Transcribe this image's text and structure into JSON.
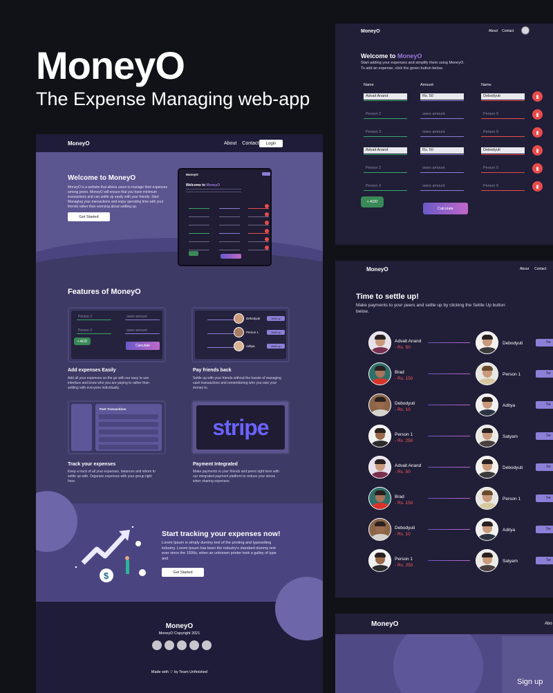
{
  "hero": {
    "title": "MoneyO",
    "subtitle": "The Expense Managing web-app"
  },
  "landing": {
    "nav": {
      "brand": "MoneyO",
      "links": [
        "About",
        "Contact"
      ],
      "login": "Login"
    },
    "welcome_title": "Welcome to MoneyO",
    "welcome_text": "MoneyO is a website that allows users to manage their expenses among peers. MoneyO will ensure that you have minimum transactions and can settle up easily with your friends. Start Managing your transactions and enjoy spending time with your friends rather than worrying about settling up.",
    "get_started": "Get Started",
    "features_title": "Features of MoneyO",
    "features": [
      {
        "title": "Add expenses Easily",
        "text": "Add all your expenses on the go with our easy to use interface and know who you are paying to rather than settling with everyone individually."
      },
      {
        "title": "Pay friends back",
        "text": "Settle up with your friends without the hassle of managing cash transactions and remembering who you owe your money to."
      },
      {
        "title": "Track your expenses",
        "text": "Keep a track of all your expenses, balances and whom to settle up with. Organize expenses with your group right here."
      },
      {
        "title": "Payment Integrated",
        "text": "Make payments to your friends and peers right here with our integrated payment platform to reduce your stress when sharing expenses."
      }
    ],
    "feature1_card": {
      "person2": "Person 2",
      "person3": "Person 3",
      "owes": "owes amount",
      "add": "+ ADD",
      "calculate": "Calculate"
    },
    "feature2_card": {
      "names": [
        "Debodyuti",
        "Person 1",
        "Aditya"
      ],
      "btn": "Settle up"
    },
    "feature3_card": {
      "title": "Past Transactions"
    },
    "stripe": "stripe",
    "cta_title": "Start tracking your expenses now!",
    "cta_text": "Lorem Ipsum is simply dummy text of the printing and typesetting industry. Lorem Ipsum has been the industry's standard dummy text ever since the 1500s, when an unknown printer took a galley of type and",
    "cta_btn": "Get Started",
    "footer": {
      "brand": "MoneyO",
      "copyright": "MoneyO Copyright 2021",
      "made": "Made with ♡ by Team Unfinished"
    }
  },
  "expense_panel": {
    "brand": "MoneyO",
    "links": [
      "About",
      "Contact"
    ],
    "welcome_prefix": "Welcome to ",
    "welcome_brand": "MoneyO",
    "sub1": "Start adding your expenses and simplify them using MoneyO.",
    "sub2": "To add an expense, click the green button below.",
    "headers": [
      "Name",
      "Amount",
      "Name"
    ],
    "rows": [
      {
        "a": "Advait Anand",
        "amt": "Rs. 50",
        "b": "Debodyuti",
        "filled": true
      },
      {
        "a": "Person 2",
        "amt": "owes amount",
        "b": "Person 5",
        "filled": false
      },
      {
        "a": "Person 3",
        "amt": "owes amount",
        "b": "Person 6",
        "filled": false
      },
      {
        "a": "Advait Anand",
        "amt": "Rs. 50",
        "b": "Debodyuti",
        "filled": true
      },
      {
        "a": "Person 2",
        "amt": "owes amount",
        "b": "Person 5",
        "filled": false
      },
      {
        "a": "Person 3",
        "amt": "owes amount",
        "b": "Person 6",
        "filled": false
      }
    ],
    "add": "+ ADD",
    "calculate": "Calculate"
  },
  "settle_panel": {
    "brand": "MoneyO",
    "links": [
      "About",
      "Contact"
    ],
    "title": "Time to settle up!",
    "subtitle": "Make payments to your peers and settle up by clicking the Settle Up button below.",
    "rows": [
      {
        "payer": "Advait Anand",
        "amount": "- Rs. 50",
        "payee": "Debodyuti"
      },
      {
        "payer": "Brad",
        "amount": "- Rs. 150",
        "payee": "Person 1"
      },
      {
        "payer": "Debodyuti",
        "amount": "- Rs. 10",
        "payee": "Aditya"
      },
      {
        "payer": "Person 1",
        "amount": "- Rs. 250",
        "payee": "Satyam"
      },
      {
        "payer": "Advait Anand",
        "amount": "- Rs. 50",
        "payee": "Debodyuti"
      },
      {
        "payer": "Brad",
        "amount": "- Rs. 150",
        "payee": "Person 1"
      },
      {
        "payer": "Debodyuti",
        "amount": "- Rs. 10",
        "payee": "Aditya"
      },
      {
        "payer": "Person 1",
        "amount": "- Rs. 250",
        "payee": "Satyam"
      }
    ],
    "btn": "Se"
  },
  "signup_panel": {
    "brand": "MoneyO",
    "link": "Abo",
    "signup": "Sign up"
  },
  "colors": {
    "background": "#111217",
    "panel": "#211e37",
    "accent": "#9b7ad9",
    "danger": "#e84c4c",
    "success": "#3a8a57"
  }
}
